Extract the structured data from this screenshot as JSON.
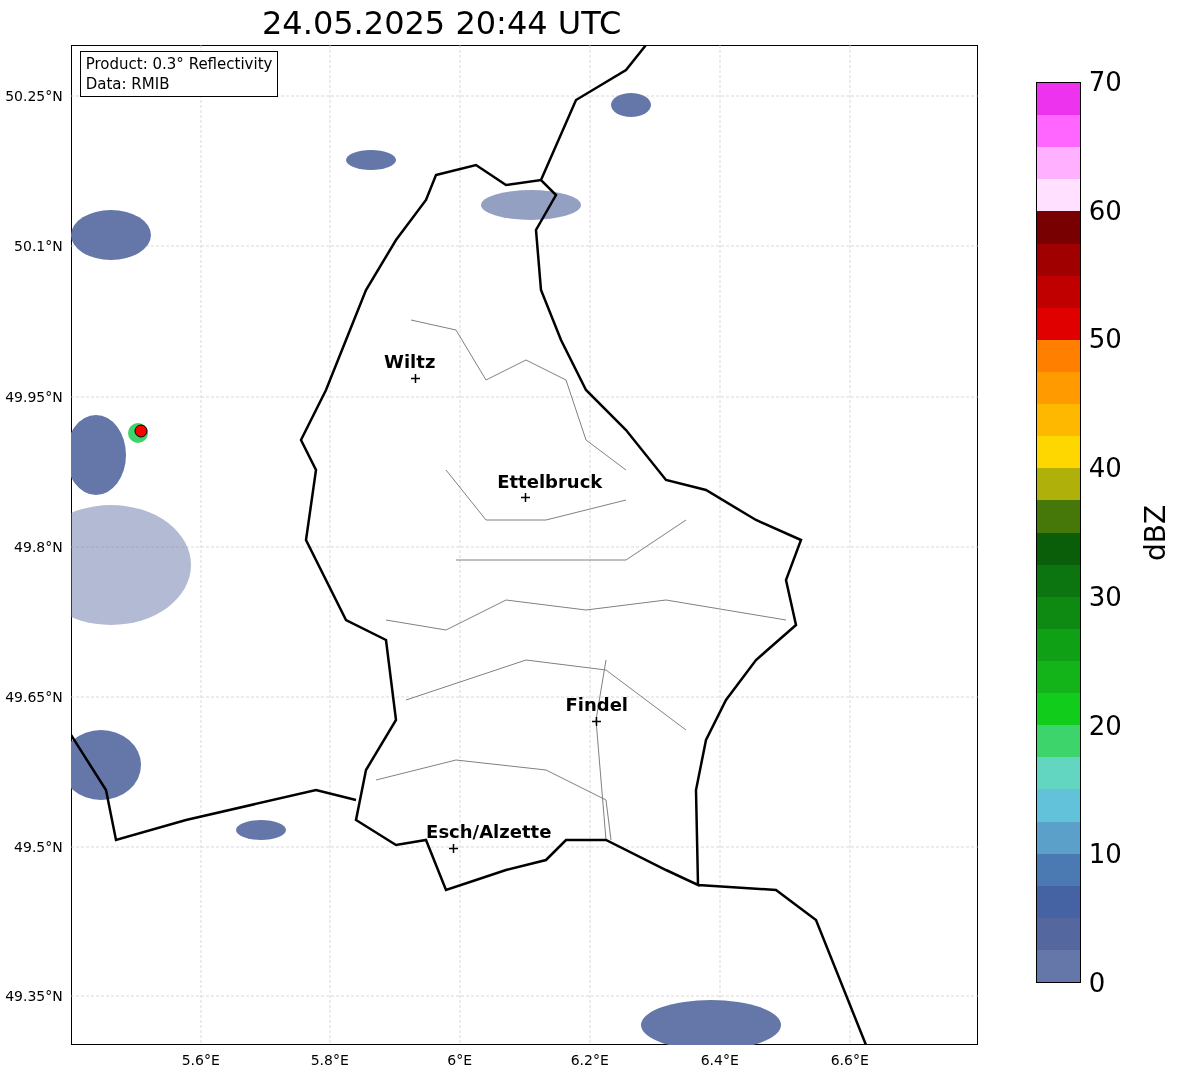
{
  "title": "24.05.2025 20:44 UTC",
  "info_box": {
    "lines": [
      "Product: 0.3° Reflectivity",
      "Data: RMIB"
    ]
  },
  "map": {
    "cities": [
      {
        "name": "Wiltz"
      },
      {
        "name": "Ettelbruck"
      },
      {
        "name": "Findel"
      },
      {
        "name": "Esch/Alzette"
      }
    ],
    "y_ticks": [
      "50.25°N",
      "50.1°N",
      "49.95°N",
      "49.8°N",
      "49.65°N",
      "49.5°N",
      "49.35°N"
    ],
    "x_ticks": [
      "5.6°E",
      "5.8°E",
      "6°E",
      "6.2°E",
      "6.4°E",
      "6.6°E"
    ]
  },
  "colorbar": {
    "label": "dBZ",
    "ticks": [
      "70",
      "60",
      "50",
      "40",
      "30",
      "20",
      "10",
      "0"
    ],
    "segments": [
      {
        "color": "#ee33ee"
      },
      {
        "color": "#ff66ff"
      },
      {
        "color": "#ffb0ff"
      },
      {
        "color": "#ffe0ff"
      },
      {
        "color": "#780000"
      },
      {
        "color": "#a00000"
      },
      {
        "color": "#c00000"
      },
      {
        "color": "#e00000"
      },
      {
        "color": "#ff8000"
      },
      {
        "color": "#ff9a00"
      },
      {
        "color": "#ffb800"
      },
      {
        "color": "#ffd700"
      },
      {
        "color": "#b0b00a"
      },
      {
        "color": "#457808"
      },
      {
        "color": "#0a5e0a"
      },
      {
        "color": "#0d7510"
      },
      {
        "color": "#0e8a12"
      },
      {
        "color": "#10a016"
      },
      {
        "color": "#12b41a"
      },
      {
        "color": "#12cc1c"
      },
      {
        "color": "#3ed46c"
      },
      {
        "color": "#62d6c0"
      },
      {
        "color": "#62c2d9"
      },
      {
        "color": "#5ba0c8"
      },
      {
        "color": "#4a7ab1"
      },
      {
        "color": "#4562a3"
      },
      {
        "color": "#55679f"
      },
      {
        "color": "#6577a8"
      }
    ]
  }
}
